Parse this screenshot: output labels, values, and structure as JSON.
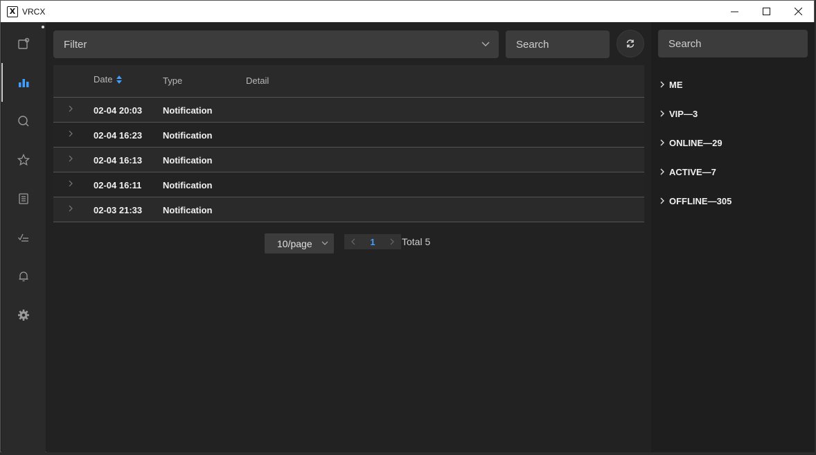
{
  "window": {
    "title": "VRCX"
  },
  "nav": {
    "items": [
      {
        "name": "friends-icon"
      },
      {
        "name": "chart-icon",
        "active": true
      },
      {
        "name": "search-icon"
      },
      {
        "name": "star-icon"
      },
      {
        "name": "notes-icon"
      },
      {
        "name": "checklist-icon"
      },
      {
        "name": "bell-icon"
      },
      {
        "name": "gear-icon"
      }
    ]
  },
  "toolbar": {
    "filter_placeholder": "Filter",
    "search_placeholder": "Search"
  },
  "table": {
    "columns": [
      "Date",
      "Type",
      "Detail"
    ],
    "rows": [
      {
        "date": "02-04 20:03",
        "type": "Notification",
        "detail": ""
      },
      {
        "date": "02-04 16:23",
        "type": "Notification",
        "detail": ""
      },
      {
        "date": "02-04 16:13",
        "type": "Notification",
        "detail": ""
      },
      {
        "date": "02-04 16:11",
        "type": "Notification",
        "detail": ""
      },
      {
        "date": "02-03 21:33",
        "type": "Notification",
        "detail": ""
      }
    ]
  },
  "pagination": {
    "page_size": "10/page",
    "current_page": "1",
    "total": "Total 5"
  },
  "sidebar_right": {
    "search_placeholder": "Search",
    "groups": [
      "ME",
      "VIP—3",
      "ONLINE—29",
      "ACTIVE—7",
      "OFFLINE—305"
    ]
  },
  "colors": {
    "accent": "#409eff",
    "background": "#1f1f1f"
  }
}
